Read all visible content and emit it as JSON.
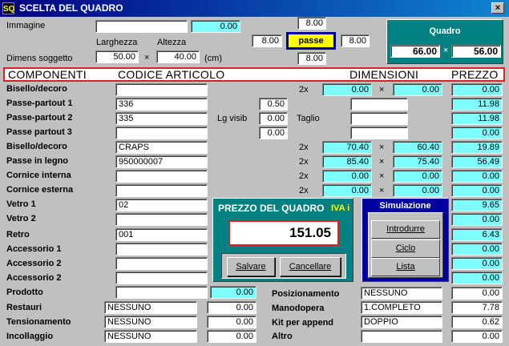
{
  "window": {
    "title": "SCELTA DEL QUADRO",
    "close_glyph": "×",
    "icon_letters": "SQ"
  },
  "top": {
    "immagine_label": "Immagine",
    "immagine_value": "",
    "immagine_num": "0.00",
    "larghezza_label": "Larghezza",
    "altezza_label": "Altezza",
    "dimens_label": "Dimens soggetto",
    "larghezza_value": "50.00",
    "x_sep": "×",
    "altezza_value": "40.00",
    "unit": "(cm)",
    "passe_top": "8.00",
    "passe_left": "8.00",
    "passe_right": "8.00",
    "passe_bottom": "8.00",
    "passe_label": "passe"
  },
  "quadro": {
    "title": "Quadro",
    "width": "66.00",
    "x": "×",
    "height": "56.00"
  },
  "header": {
    "componenti": "COMPONENTI",
    "codice": "CODICE ARTICOLO",
    "dimensioni": "DIMENSIONI",
    "prezzo": "PREZZO"
  },
  "rows": [
    {
      "label": "Bisello/decoro",
      "code": "",
      "mult": "2x",
      "d1": "0.00",
      "dx": "×",
      "d2": "0.00",
      "price": "0.00"
    },
    {
      "label": "Passe-partout 1",
      "code": "336",
      "price": "11.98"
    },
    {
      "label": "Passe-partout 2",
      "code": "335",
      "price": "11.98"
    },
    {
      "label": "Passe partout 3",
      "code": "",
      "price": "0.00"
    },
    {
      "label": "Bisello/decoro",
      "code": "CRAPS",
      "mult": "2x",
      "d1": "70.40",
      "dx": "×",
      "d2": "60.40",
      "price": "19.89"
    },
    {
      "label": "Passe in legno",
      "code": "950000007",
      "mult": "2x",
      "d1": "85.40",
      "dx": "×",
      "d2": "75.40",
      "price": "56.49"
    },
    {
      "label": "Cornice interna",
      "code": "",
      "mult": "2x",
      "d1": "0.00",
      "dx": "×",
      "d2": "0.00",
      "price": "0.00"
    },
    {
      "label": "Cornice esterna",
      "code": "",
      "mult": "2x",
      "d1": "0.00",
      "dx": "×",
      "d2": "0.00",
      "price": "0.00"
    },
    {
      "label": "Vetro 1",
      "code": "02",
      "price": "9.65"
    },
    {
      "label": "Vetro 2",
      "code": "",
      "price": "0.00"
    },
    {
      "label": "Retro",
      "code": "001",
      "price": "6.43"
    },
    {
      "label": "Accessorio 1",
      "code": "",
      "price": "0.00"
    },
    {
      "label": "Accessorio 2",
      "code": "",
      "price": "0.00"
    },
    {
      "label": "Accessorio 2",
      "code": "",
      "price": "0.00"
    }
  ],
  "passe_extra": {
    "lg_visib_label": "Lg visib",
    "taglio_label": "Taglio",
    "v1": "0.50",
    "v2": "0.00",
    "v3": "0.00",
    "taglio_value": "",
    "extra1": "",
    "extra2": ""
  },
  "prodotto": {
    "label": "Prodotto",
    "code": "",
    "value": "0.00"
  },
  "bottom_left": [
    {
      "label": "Restauri",
      "value": "NESSUNO",
      "num": "0.00"
    },
    {
      "label": "Tensionamento",
      "value": "NESSUNO",
      "num": "0.00"
    },
    {
      "label": "Incollaggio",
      "value": "NESSUNO",
      "num": "0.00"
    }
  ],
  "bottom_right": [
    {
      "label": "Posizionamento",
      "value": "NESSUNO",
      "price": "0.00"
    },
    {
      "label": "Manodopera",
      "value": "1.COMPLETO",
      "price": "7.78"
    },
    {
      "label": "Kit per append",
      "value": "DOPPIO",
      "price": "0.62"
    },
    {
      "label": "Altro",
      "value": "",
      "price": "0.00"
    }
  ],
  "price_box": {
    "title": "PREZZO DEL QUADRO",
    "iva": "IVA i",
    "total": "151.05",
    "save": "Salvare",
    "cancel": "Cancellare"
  },
  "simulazione": {
    "title": "Simulazione",
    "btn1": "Introdurre",
    "btn2": "Ciclo",
    "btn3": "Lista"
  }
}
